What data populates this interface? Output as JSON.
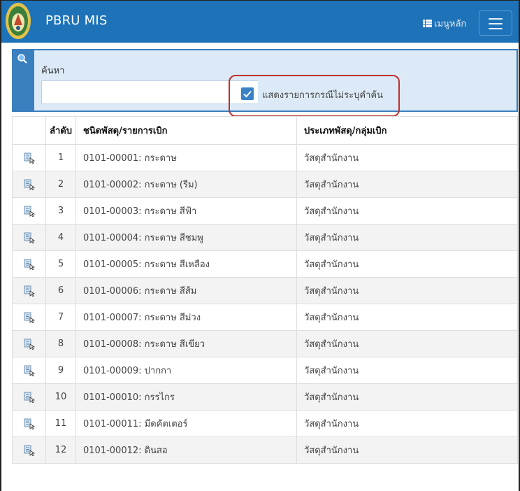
{
  "app": {
    "brand": "PBRU MIS",
    "menu_label": "เมนูหลัก"
  },
  "search": {
    "label": "ค้นหา",
    "value": "",
    "checkbox_label": "แสดงรายการกรณีไม่ระบุคำค้น",
    "checkbox_checked": true
  },
  "table": {
    "headers": {
      "index": "ลำดับ",
      "item": "ชนิดพัสดุ/รายการเบิก",
      "type": "ประเภทพัสดุ/กลุ่มเบิก"
    },
    "rows": [
      {
        "index": "1",
        "item": "0101-00001: กระดาษ",
        "type": "วัสดุสำนักงาน"
      },
      {
        "index": "2",
        "item": "0101-00002: กระดาษ (รีม)",
        "type": "วัสดุสำนักงาน"
      },
      {
        "index": "3",
        "item": "0101-00003: กระดาษ สีฟ้า",
        "type": "วัสดุสำนักงาน"
      },
      {
        "index": "4",
        "item": "0101-00004: กระดาษ สีชมพู",
        "type": "วัสดุสำนักงาน"
      },
      {
        "index": "5",
        "item": "0101-00005: กระดาษ สีเหลือง",
        "type": "วัสดุสำนักงาน"
      },
      {
        "index": "6",
        "item": "0101-00006: กระดาษ สีส้ม",
        "type": "วัสดุสำนักงาน"
      },
      {
        "index": "7",
        "item": "0101-00007: กระดาษ สีม่วง",
        "type": "วัสดุสำนักงาน"
      },
      {
        "index": "8",
        "item": "0101-00008: กระดาษ สีเขียว",
        "type": "วัสดุสำนักงาน"
      },
      {
        "index": "9",
        "item": "0101-00009: ปากกา",
        "type": "วัสดุสำนักงาน"
      },
      {
        "index": "10",
        "item": "0101-00010: กรรไกร",
        "type": "วัสดุสำนักงาน"
      },
      {
        "index": "11",
        "item": "0101-00011: มีดคัตเตอร์",
        "type": "วัสดุสำนักงาน"
      },
      {
        "index": "12",
        "item": "0101-00012: ดินสอ",
        "type": "วัสดุสำนักงาน"
      }
    ]
  },
  "colors": {
    "navbar": "#1e73b8",
    "panel": "#dbeaf6",
    "accent": "#3a7fbe",
    "highlight": "#c03030"
  }
}
